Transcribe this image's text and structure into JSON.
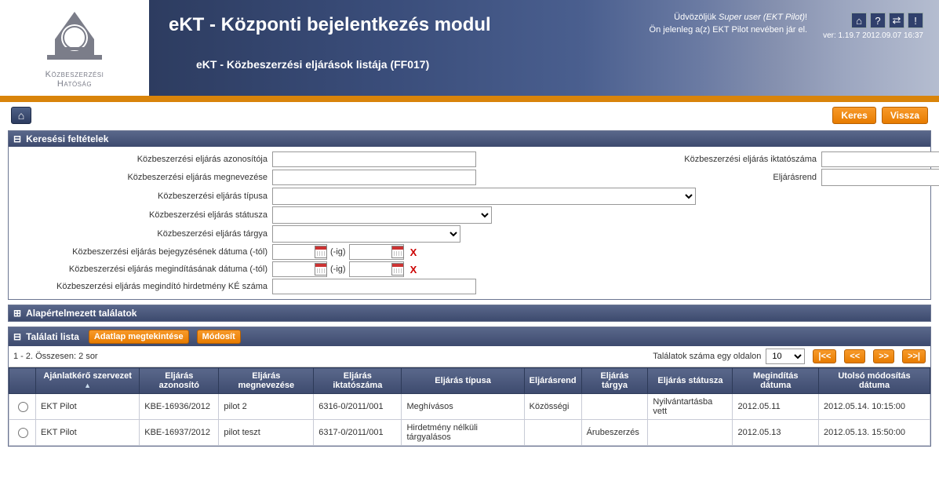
{
  "logo": {
    "line1": "Közbeszerzési",
    "line2": "Hatóság"
  },
  "header": {
    "app_title": "eKT - Központi bejelentkezés modul",
    "page_subtitle": "eKT - Közbeszerzési eljárások listája (FF017)",
    "welcome_prefix": "Üdvözöljük ",
    "welcome_user": "Super user (EKT Pilot)",
    "welcome_suffix": "!",
    "acting_text": "Ön jelenleg a(z) EKT Pilot nevében jár el.",
    "version": "ver: 1.19.7 2012.09.07 16:37"
  },
  "buttons": {
    "search": "Keres",
    "back": "Vissza",
    "view": "Adatlap megtekintése",
    "edit": "Módosít",
    "first": "|<<",
    "prev": "<<",
    "next": ">>",
    "last": ">>|"
  },
  "panels": {
    "search_title": "Keresési feltételek",
    "default_results_title": "Alapértelmezett találatok",
    "hits_title": "Találati lista"
  },
  "search_labels": {
    "proc_id": "Közbeszerzési eljárás azonosítója",
    "proc_ref": "Közbeszerzési eljárás iktatószáma",
    "proc_name": "Közbeszerzési eljárás megnevezése",
    "regime": "Eljárásrend",
    "proc_type": "Közbeszerzési eljárás típusa",
    "proc_status": "Közbeszerzési eljárás státusza",
    "proc_subject": "Közbeszerzési eljárás tárgya",
    "date_reg_from": "Közbeszerzési eljárás bejegyzésének dátuma (-tól)",
    "date_start_from": "Közbeszerzési eljárás megindításának dátuma (-tól)",
    "ke_number": "Közbeszerzési eljárás megindító hirdetmény KÉ száma",
    "to_suffix": "(-ig)"
  },
  "results_meta": {
    "range_text": "1 - 2. Összesen: 2 sor",
    "page_size_label": "Találatok száma egy oldalon",
    "page_size_value": "10"
  },
  "columns": {
    "org": "Ajánlatkérő szervezet",
    "proc_id": "Eljárás azonosító",
    "proc_name": "Eljárás megnevezése",
    "proc_ref": "Eljárás iktatószáma",
    "proc_type": "Eljárás típusa",
    "regime": "Eljárásrend",
    "subject": "Eljárás tárgya",
    "status": "Eljárás státusza",
    "start_date": "Megindítás dátuma",
    "mod_date": "Utolsó módosítás dátuma"
  },
  "rows": [
    {
      "org": "EKT Pilot",
      "proc_id": "KBE-16936/2012",
      "proc_name": "pilot 2",
      "proc_ref": "6316-0/2011/001",
      "proc_type": "Meghívásos",
      "regime": "Közösségi",
      "subject": "",
      "status": "Nyilvántartásba vett",
      "start_date": "2012.05.11",
      "mod_date": "2012.05.14. 10:15:00"
    },
    {
      "org": "EKT Pilot",
      "proc_id": "KBE-16937/2012",
      "proc_name": "pilot teszt",
      "proc_ref": "6317-0/2011/001",
      "proc_type": "Hirdetmény nélküli tárgyalásos",
      "regime": "",
      "subject": "Árubeszerzés",
      "status": "",
      "start_date": "2012.05.13",
      "mod_date": "2012.05.13. 15:50:00"
    }
  ]
}
